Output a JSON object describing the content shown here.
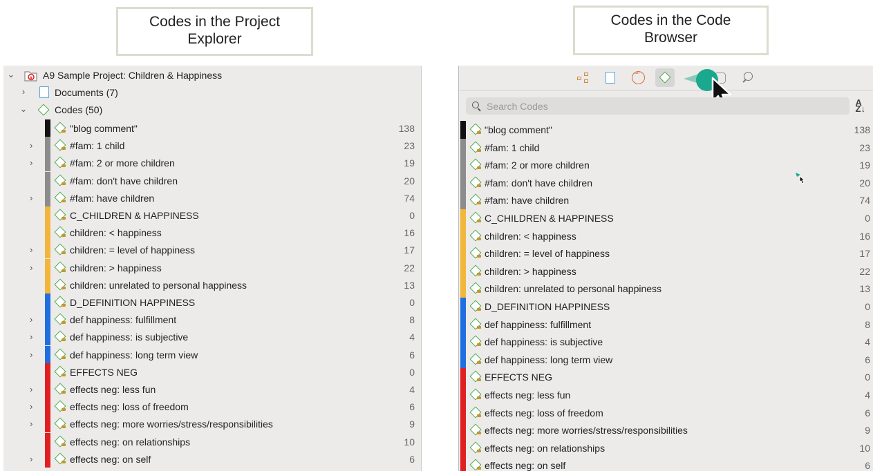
{
  "captions": {
    "left": [
      "Codes in the Project",
      "Explorer"
    ],
    "right": [
      "Codes in the Code",
      "Browser"
    ]
  },
  "project_explorer": {
    "project_title": "A9 Sample Project: Children & Happiness",
    "documents_label": "Documents (7)",
    "codes_label": "Codes (50)",
    "codes": [
      {
        "label": "\"blog comment\"",
        "count": "138",
        "color": "#111111",
        "expandable": false
      },
      {
        "label": "#fam: 1 child",
        "count": "23",
        "color": "#8c8c8c",
        "expandable": true
      },
      {
        "label": "#fam: 2 or more  children",
        "count": "19",
        "color": "#8c8c8c",
        "expandable": true
      },
      {
        "label": "#fam: don't have children",
        "count": "20",
        "color": "#8c8c8c",
        "expandable": false
      },
      {
        "label": "#fam: have children",
        "count": "74",
        "color": "#8c8c8c",
        "expandable": true
      },
      {
        "label": "C_CHILDREN & HAPPINESS",
        "count": "0",
        "color": "#f2b63a",
        "expandable": false
      },
      {
        "label": "children: < happiness",
        "count": "16",
        "color": "#f2b63a",
        "expandable": false
      },
      {
        "label": "children: = level of happiness",
        "count": "17",
        "color": "#f2b63a",
        "expandable": true
      },
      {
        "label": "children: > happiness",
        "count": "22",
        "color": "#f2b63a",
        "expandable": true
      },
      {
        "label": "children: unrelated to personal happiness",
        "count": "13",
        "color": "#f2b63a",
        "expandable": false
      },
      {
        "label": "D_DEFINITION HAPPINESS",
        "count": "0",
        "color": "#1f6fe0",
        "expandable": false
      },
      {
        "label": "def happiness: fulfillment",
        "count": "8",
        "color": "#1f6fe0",
        "expandable": true
      },
      {
        "label": "def happiness: is subjective",
        "count": "4",
        "color": "#1f6fe0",
        "expandable": true
      },
      {
        "label": "def happiness: long term view",
        "count": "6",
        "color": "#1f6fe0",
        "expandable": true
      },
      {
        "label": "EFFECTS NEG",
        "count": "0",
        "color": "#e02020",
        "expandable": false
      },
      {
        "label": "effects neg: less fun",
        "count": "4",
        "color": "#e02020",
        "expandable": true
      },
      {
        "label": "effects neg: loss of freedom",
        "count": "6",
        "color": "#e02020",
        "expandable": true
      },
      {
        "label": "effects neg: more worries/stress/responsibilities",
        "count": "9",
        "color": "#e02020",
        "expandable": true
      },
      {
        "label": "effects neg: on relationships",
        "count": "10",
        "color": "#e02020",
        "expandable": false
      },
      {
        "label": "effects neg: on self",
        "count": "6",
        "color": "#e02020",
        "expandable": true
      }
    ]
  },
  "code_browser": {
    "search_placeholder": "Search Codes",
    "sort_label": "A↓Z",
    "codes": [
      {
        "label": "\"blog comment\"",
        "count": "138",
        "color": "#111111"
      },
      {
        "label": "#fam: 1 child",
        "count": "23",
        "color": "#8c8c8c"
      },
      {
        "label": "#fam: 2 or more  children",
        "count": "19",
        "color": "#8c8c8c"
      },
      {
        "label": "#fam: don't have children",
        "count": "20",
        "color": "#8c8c8c"
      },
      {
        "label": "#fam: have children",
        "count": "74",
        "color": "#8c8c8c"
      },
      {
        "label": "C_CHILDREN & HAPPINESS",
        "count": "0",
        "color": "#f2b63a"
      },
      {
        "label": "children: < happiness",
        "count": "16",
        "color": "#f2b63a"
      },
      {
        "label": "children: = level of happiness",
        "count": "17",
        "color": "#f2b63a"
      },
      {
        "label": "children: > happiness",
        "count": "22",
        "color": "#f2b63a"
      },
      {
        "label": "children: unrelated to personal happiness",
        "count": "13",
        "color": "#f2b63a"
      },
      {
        "label": "D_DEFINITION HAPPINESS",
        "count": "0",
        "color": "#1f6fe0"
      },
      {
        "label": "def happiness: fulfillment",
        "count": "8",
        "color": "#1f6fe0"
      },
      {
        "label": "def happiness: is subjective",
        "count": "4",
        "color": "#1f6fe0"
      },
      {
        "label": "def happiness: long term view",
        "count": "6",
        "color": "#1f6fe0"
      },
      {
        "label": "EFFECTS NEG",
        "count": "0",
        "color": "#e02020"
      },
      {
        "label": "effects neg: less fun",
        "count": "4",
        "color": "#e02020"
      },
      {
        "label": "effects neg: loss of freedom",
        "count": "6",
        "color": "#e02020"
      },
      {
        "label": "effects neg: more worries/stress/responsibilities",
        "count": "9",
        "color": "#e02020"
      },
      {
        "label": "effects neg: on relationships",
        "count": "10",
        "color": "#e02020"
      },
      {
        "label": "effects neg: on self",
        "count": "6",
        "color": "#e02020"
      }
    ]
  }
}
